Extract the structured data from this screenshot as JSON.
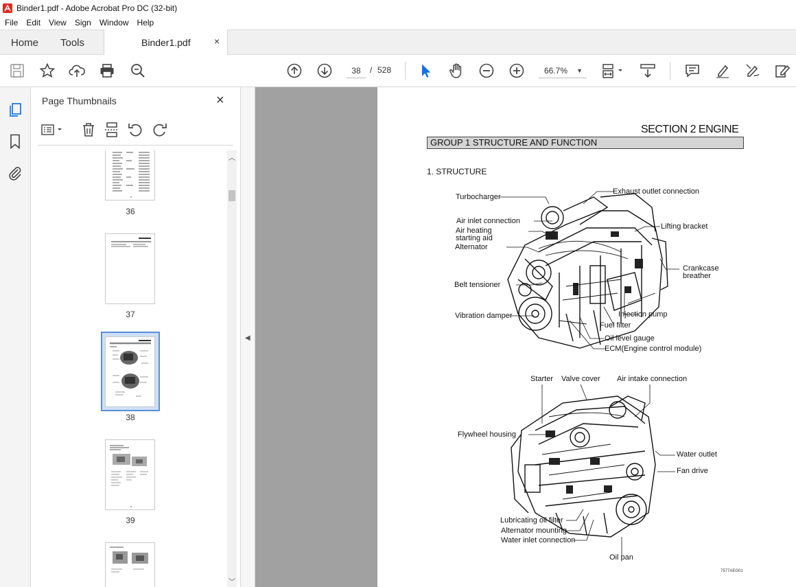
{
  "window": {
    "title": "Binder1.pdf - Adobe Acrobat Pro DC (32-bit)"
  },
  "menu": [
    "File",
    "Edit",
    "View",
    "Sign",
    "Window",
    "Help"
  ],
  "tabs": {
    "home": "Home",
    "tools": "Tools",
    "document": "Binder1.pdf",
    "close_glyph": "×"
  },
  "toolbar": {
    "current_page": "38",
    "separator": "/",
    "page_count": "528",
    "zoom": "66.7%",
    "icons": [
      "save-icon",
      "star-icon",
      "upload-icon",
      "print-icon",
      "search-zoom-icon",
      "page-up-icon",
      "page-down-icon",
      "select-cursor-icon",
      "hand-icon",
      "zoom-out-icon",
      "zoom-in-icon",
      "fit-page-icon",
      "scroll-mode-icon",
      "comment-icon",
      "highlight-icon",
      "sign-icon",
      "edit-pdf-icon"
    ],
    "accent_color": "#1473e6"
  },
  "sidebar": {
    "panel_title": "Page Thumbnails",
    "close_glyph": "×",
    "thumbnails": [
      {
        "page": "36"
      },
      {
        "page": "37"
      },
      {
        "page": "38",
        "selected": true
      },
      {
        "page": "39"
      }
    ]
  },
  "document": {
    "section_title": "SECTION 2  ENGINE",
    "group_title": "GROUP  1  STRUCTURE AND FUNCTION",
    "structure_heading": "1. STRUCTURE",
    "figure_code": "7577AEG01",
    "top_labels": {
      "turbocharger": "Turbocharger",
      "exhaust_outlet": "Exhaust outlet connection",
      "air_inlet": "Air inlet connection",
      "air_heating_1": "Air heating",
      "air_heating_2": "starting aid",
      "alternator": "Alternator",
      "lifting_bracket": "Lifting bracket",
      "crankcase_1": "Crankcase",
      "crankcase_2": "breather",
      "belt_tensioner": "Belt tensioner",
      "injection_pump": "Injection pump",
      "vibration_damper": "Vibration damper",
      "fuel_filter": "Fuel filter",
      "oil_level_gauge": "Oil level gauge",
      "ecm": "ECM(Engine control module)"
    },
    "bottom_labels": {
      "starter": "Starter",
      "valve_cover": "Valve cover",
      "air_intake": "Air intake connection",
      "flywheel_housing": "Flywheel housing",
      "water_outlet": "Water outlet",
      "fan_drive": "Fan drive",
      "lube_filter": "Lubricating oil filter",
      "alternator_mounting": "Alternator mounting",
      "water_inlet": "Water inlet connection",
      "oil_pan": "Oil pan"
    }
  }
}
